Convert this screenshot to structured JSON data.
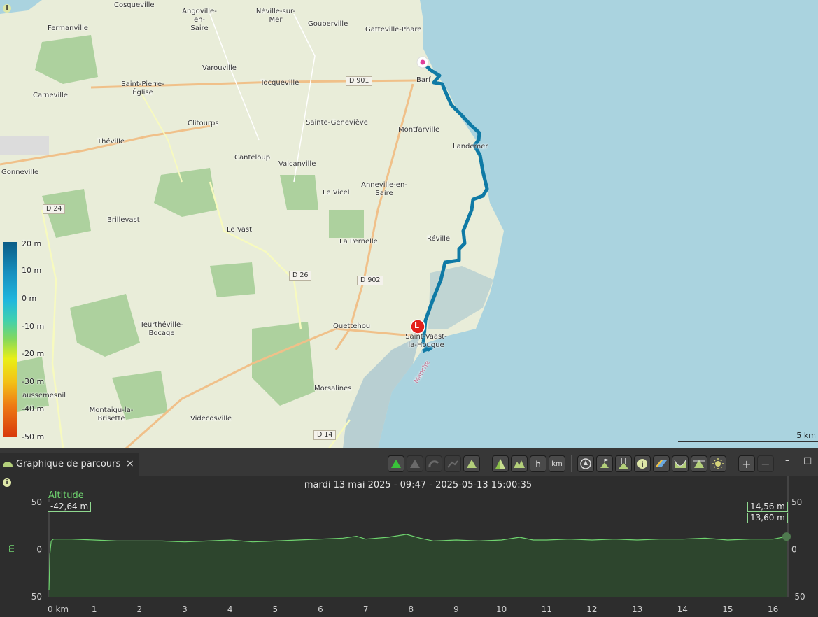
{
  "map": {
    "info_icon": "i",
    "places": [
      {
        "name": "Cosqueville"
      },
      {
        "name": "Angoville-en-\nSaire"
      },
      {
        "name": "Néville-sur-\nMer"
      },
      {
        "name": "Gouberville"
      },
      {
        "name": "Gatteville-Phare"
      },
      {
        "name": "Fermanville"
      },
      {
        "name": "Varouville"
      },
      {
        "name": "Saint-Pierre-\nÉglise"
      },
      {
        "name": "Tocqueville"
      },
      {
        "name": "Barf"
      },
      {
        "name": "Carneville"
      },
      {
        "name": "Clitourps"
      },
      {
        "name": "Sainte-Geneviève"
      },
      {
        "name": "Montfarville"
      },
      {
        "name": "Landemer"
      },
      {
        "name": "Théville"
      },
      {
        "name": "Canteloup"
      },
      {
        "name": "Valcanville"
      },
      {
        "name": "Gonneville"
      },
      {
        "name": "Anneville-en-\nSaire"
      },
      {
        "name": "Le Vicel"
      },
      {
        "name": "Brillevast"
      },
      {
        "name": "Le Vast"
      },
      {
        "name": "La Pernelle"
      },
      {
        "name": "Réville"
      },
      {
        "name": "Teurthéville-\nBocage"
      },
      {
        "name": "Quettehou"
      },
      {
        "name": "Saint-Vaast-\nla-Hougue"
      },
      {
        "name": "Morsalines"
      },
      {
        "name": "aussemesnil"
      },
      {
        "name": "Montaigu-la-\nBrisette"
      },
      {
        "name": "Videcosville"
      },
      {
        "name": "Manche"
      }
    ],
    "roads": [
      {
        "name": "D 901"
      },
      {
        "name": "D 24"
      },
      {
        "name": "D 26"
      },
      {
        "name": "D 902"
      },
      {
        "name": "D 14"
      }
    ],
    "legend": {
      "labels": [
        "20  m",
        "10  m",
        "0  m",
        "-10  m",
        "-20  m",
        "-30  m",
        "-40  m",
        "-50  m"
      ]
    },
    "scale_label": "5 km",
    "start_marker": "start-pin-icon",
    "end_marker": {
      "letter": "L",
      "icon": "end-flag-icon"
    },
    "track_color": "#0f7aa5"
  },
  "panel": {
    "tab_label": "Graphique de parcours",
    "tab_close": "×",
    "toolbar_icons": [
      {
        "name": "altitude-graph-icon",
        "active": true
      },
      {
        "name": "slope-graph-icon",
        "active": false
      },
      {
        "name": "speed-graph-icon",
        "active": false
      },
      {
        "name": "pace-graph-icon",
        "active": false
      },
      {
        "name": "altitude-alt-icon",
        "active": true
      },
      {
        "name": "compare-profile-icon",
        "active": true
      },
      {
        "name": "multi-peak-icon",
        "active": true
      },
      {
        "name": "time-axis-icon",
        "active": true
      },
      {
        "name": "distance-axis-icon",
        "active": true
      },
      {
        "name": "center-map-icon",
        "active": true
      },
      {
        "name": "start-flag-icon",
        "active": true
      },
      {
        "name": "pause-markers-icon",
        "active": true
      },
      {
        "name": "info-icon",
        "active": true
      },
      {
        "name": "highlight-segment-icon",
        "active": true
      },
      {
        "name": "min-altitude-icon",
        "active": true
      },
      {
        "name": "max-altitude-icon",
        "active": true
      },
      {
        "name": "sun-icon",
        "active": true
      },
      {
        "name": "zoom-in-icon",
        "active": true
      },
      {
        "name": "zoom-out-icon",
        "active": false
      }
    ],
    "toolbar_text": {
      "time_axis": "h",
      "distance_axis": "km",
      "zoom_in": "+",
      "zoom_out": "−"
    },
    "window_buttons": {
      "minimize": "–",
      "maximize": "□"
    }
  },
  "chart_data": {
    "type": "line",
    "title": "mardi 13 mai 2025 - 09:47 - 2025-05-13 15:00:35",
    "series": [
      {
        "name": "Altitude",
        "color": "#6fd36f",
        "x": [
          0,
          0.02,
          0.05,
          0.1,
          0.5,
          1,
          1.5,
          2,
          2.5,
          3,
          3.5,
          4,
          4.5,
          5,
          5.5,
          6,
          6.5,
          6.8,
          7,
          7.5,
          7.9,
          8.2,
          8.5,
          9,
          9.5,
          10,
          10.4,
          10.7,
          11,
          11.5,
          12,
          12.5,
          13,
          13.5,
          14,
          14.5,
          15,
          15.5,
          16,
          16.3
        ],
        "y": [
          -42.64,
          -5,
          9,
          11,
          11,
          10,
          9,
          9,
          9,
          8,
          9,
          10,
          8,
          9,
          10,
          11,
          12,
          14,
          11,
          13,
          16,
          12,
          9,
          10,
          9,
          10,
          13,
          10,
          10,
          11,
          10,
          11,
          10,
          11,
          11,
          12,
          10,
          11,
          11,
          13.6
        ]
      }
    ],
    "xlabel": "",
    "ylabel": "m",
    "xlim": [
      0,
      16.3
    ],
    "ylim": [
      -50,
      50
    ],
    "x_ticks": [
      "0 km",
      "1",
      "2",
      "3",
      "4",
      "5",
      "6",
      "7",
      "8",
      "9",
      "10",
      "11",
      "12",
      "13",
      "14",
      "15",
      "16"
    ],
    "y_ticks_left": [
      "50",
      "0",
      "-50"
    ],
    "y_ticks_right": [
      "50",
      "0",
      "-50"
    ],
    "cursor_left_value": "-42,64 m",
    "right_values": [
      "14,56 m",
      "13,60 m"
    ],
    "grid": false
  }
}
